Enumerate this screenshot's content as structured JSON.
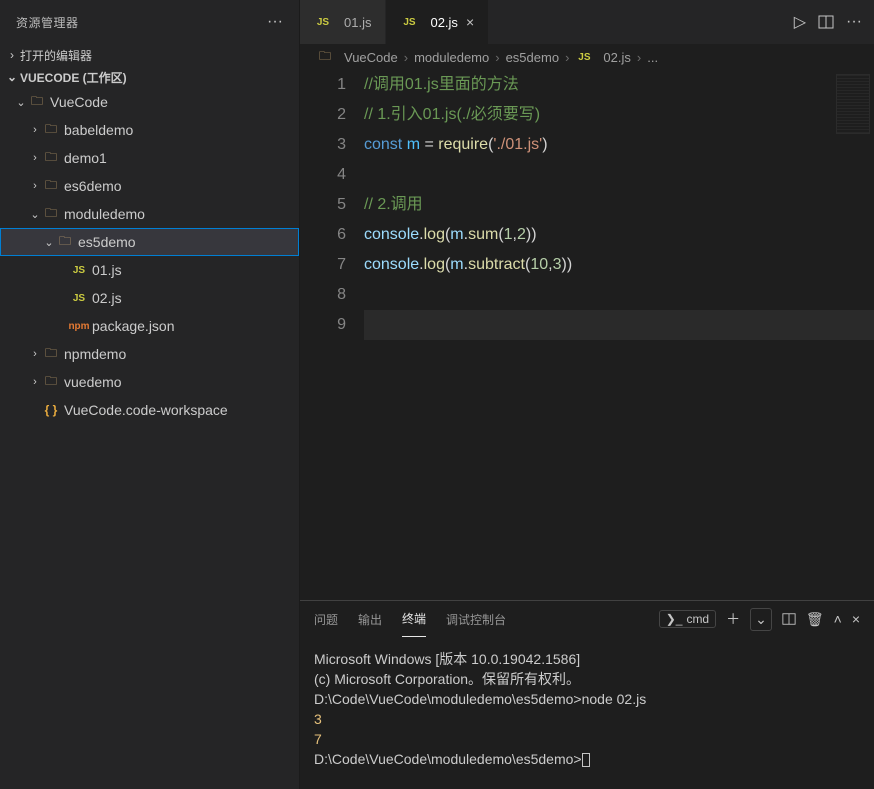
{
  "sidebar": {
    "title": "资源管理器",
    "openEditorsLabel": "打开的编辑器",
    "workspaceLabel": "VUECODE (工作区)",
    "tree": {
      "root": "VueCode",
      "items": [
        {
          "name": "babeldemo"
        },
        {
          "name": "demo1"
        },
        {
          "name": "es6demo"
        },
        {
          "name": "moduledemo",
          "open": true,
          "children": [
            {
              "name": "es5demo",
              "open": true,
              "children": [
                {
                  "name": "01.js",
                  "icon": "js"
                },
                {
                  "name": "02.js",
                  "icon": "js"
                },
                {
                  "name": "package.json",
                  "icon": "json"
                }
              ]
            }
          ]
        },
        {
          "name": "npmdemo"
        },
        {
          "name": "vuedemo"
        },
        {
          "name": "VueCode.code-workspace",
          "icon": "brackets"
        }
      ]
    }
  },
  "tabs": [
    {
      "label": "01.js",
      "icon": "js"
    },
    {
      "label": "02.js",
      "icon": "js",
      "active": true,
      "close": "×"
    }
  ],
  "breadcrumb": [
    "VueCode",
    "moduledemo",
    "es5demo",
    "02.js",
    "..."
  ],
  "code": {
    "lines": [
      {
        "n": 1,
        "tokens": [
          {
            "t": "//调用01.js里面的方法",
            "c": "comment"
          }
        ]
      },
      {
        "n": 2,
        "tokens": [
          {
            "t": "// 1.引入01.js(./必须要写)",
            "c": "comment"
          }
        ]
      },
      {
        "n": 3,
        "tokens": [
          {
            "t": "const ",
            "c": "key"
          },
          {
            "t": "m",
            "c": "var"
          },
          {
            "t": " = ",
            "c": "plain"
          },
          {
            "t": "require",
            "c": "func"
          },
          {
            "t": "(",
            "c": "plain"
          },
          {
            "t": "'./01.js'",
            "c": "str"
          },
          {
            "t": ")",
            "c": "plain"
          }
        ]
      },
      {
        "n": 4,
        "tokens": []
      },
      {
        "n": 5,
        "tokens": [
          {
            "t": "// 2.调用",
            "c": "comment"
          }
        ]
      },
      {
        "n": 6,
        "tokens": [
          {
            "t": "console",
            "c": "prop"
          },
          {
            "t": ".",
            "c": "plain"
          },
          {
            "t": "log",
            "c": "func"
          },
          {
            "t": "(",
            "c": "plain"
          },
          {
            "t": "m",
            "c": "prop"
          },
          {
            "t": ".",
            "c": "plain"
          },
          {
            "t": "sum",
            "c": "func"
          },
          {
            "t": "(",
            "c": "plain"
          },
          {
            "t": "1",
            "c": "num"
          },
          {
            "t": ",",
            "c": "plain"
          },
          {
            "t": "2",
            "c": "num"
          },
          {
            "t": "))",
            "c": "plain"
          }
        ]
      },
      {
        "n": 7,
        "tokens": [
          {
            "t": "console",
            "c": "prop"
          },
          {
            "t": ".",
            "c": "plain"
          },
          {
            "t": "log",
            "c": "func"
          },
          {
            "t": "(",
            "c": "plain"
          },
          {
            "t": "m",
            "c": "prop"
          },
          {
            "t": ".",
            "c": "plain"
          },
          {
            "t": "subtract",
            "c": "func"
          },
          {
            "t": "(",
            "c": "plain"
          },
          {
            "t": "10",
            "c": "num"
          },
          {
            "t": ",",
            "c": "plain"
          },
          {
            "t": "3",
            "c": "num"
          },
          {
            "t": "))",
            "c": "plain"
          }
        ]
      },
      {
        "n": 8,
        "tokens": []
      },
      {
        "n": 9,
        "tokens": [],
        "current": true
      }
    ]
  },
  "panel": {
    "tabs": [
      {
        "label": "问题"
      },
      {
        "label": "输出"
      },
      {
        "label": "终端",
        "active": true
      },
      {
        "label": "调试控制台"
      }
    ],
    "shell": "cmd"
  },
  "terminal": {
    "lines": [
      {
        "t": "Microsoft Windows [版本 10.0.19042.1586]"
      },
      {
        "t": "(c) Microsoft Corporation。保留所有权利。"
      },
      {
        "t": ""
      },
      {
        "t": "D:\\Code\\VueCode\\moduledemo\\es5demo>node 02.js"
      },
      {
        "t": "3",
        "c": "out"
      },
      {
        "t": "7",
        "c": "out"
      },
      {
        "t": ""
      },
      {
        "t": "D:\\Code\\VueCode\\moduledemo\\es5demo>",
        "cursor": true
      }
    ]
  },
  "icons": {
    "jsLabel": "JS",
    "jsonLabel": "npm",
    "bracketsLabel": "{ }"
  }
}
